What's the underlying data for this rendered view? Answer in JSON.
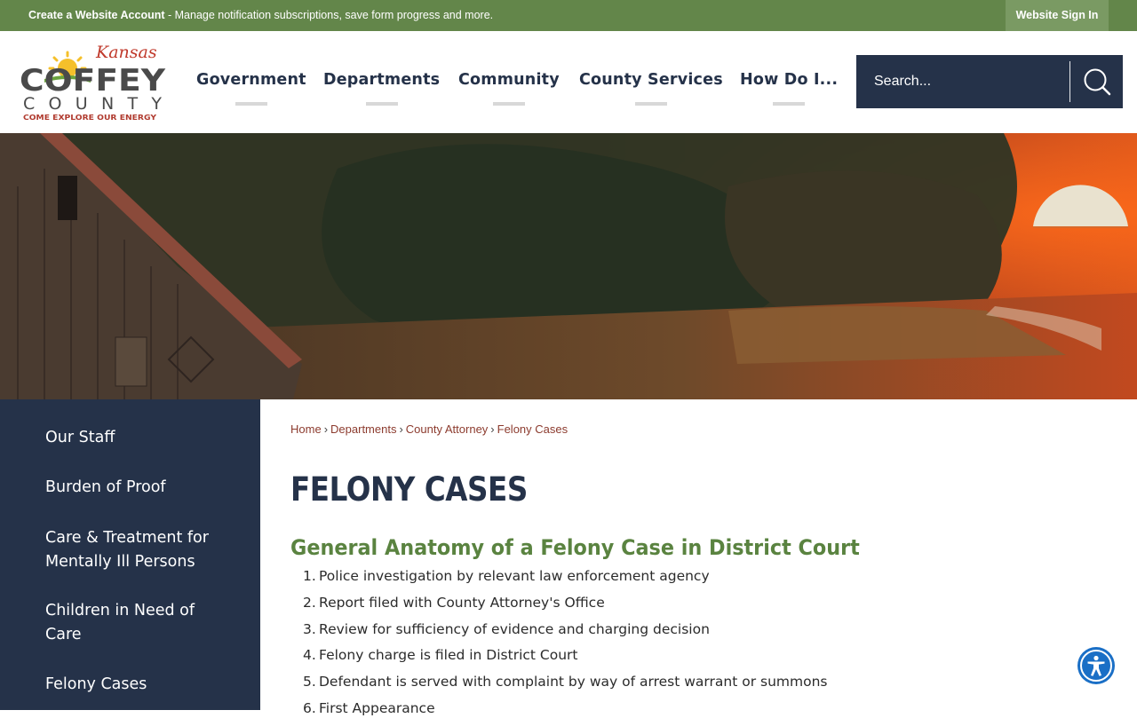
{
  "topbar": {
    "create_account": "Create a Website Account",
    "message": " - Manage notification subscriptions, save form progress and more.",
    "signin": "Website Sign In"
  },
  "logo": {
    "script": "Kansas",
    "line1": "COFFEY",
    "line2": "COUNTY",
    "tagline": "COME EXPLORE OUR ENERGY"
  },
  "nav": {
    "items": [
      {
        "label": "Government"
      },
      {
        "label": "Departments"
      },
      {
        "label": "Community"
      },
      {
        "label": "County Services"
      },
      {
        "label": "How Do I..."
      }
    ]
  },
  "search": {
    "placeholder": "Search...",
    "icon": "search-icon"
  },
  "sidebar": {
    "items": [
      {
        "label": "Our Staff"
      },
      {
        "label": "Burden of Proof"
      },
      {
        "label": "Care & Treatment for Mentally Ill Persons"
      },
      {
        "label": "Children in Need of Care"
      },
      {
        "label": "Felony Cases"
      }
    ]
  },
  "breadcrumb": {
    "items": [
      "Home",
      "Departments",
      "County Attorney"
    ],
    "separator": "›",
    "current": "Felony Cases"
  },
  "main": {
    "title": "FELONY CASES",
    "subhead": "General Anatomy of a Felony Case in District Court",
    "steps": [
      {
        "num": "1.",
        "text": "Police investigation by relevant law enforcement agency"
      },
      {
        "num": "2.",
        "text": "Report filed with County Attorney's Office"
      },
      {
        "num": "3.",
        "text": "Review for sufficiency of evidence and charging decision"
      },
      {
        "num": "4.",
        "text": "Felony charge is filed in District Court"
      },
      {
        "num": "5.",
        "text": "Defendant is served with complaint by way of arrest warrant or summons"
      },
      {
        "num": "6.",
        "text": "First Appearance"
      }
    ]
  },
  "colors": {
    "topbar_green": "#63864a",
    "navy": "#253249",
    "subhead_green": "#5a8340",
    "link_red": "#8c3b2e",
    "accessibility_blue": "#1a6fc6"
  },
  "accessibility": {
    "icon": "accessibility-icon"
  }
}
